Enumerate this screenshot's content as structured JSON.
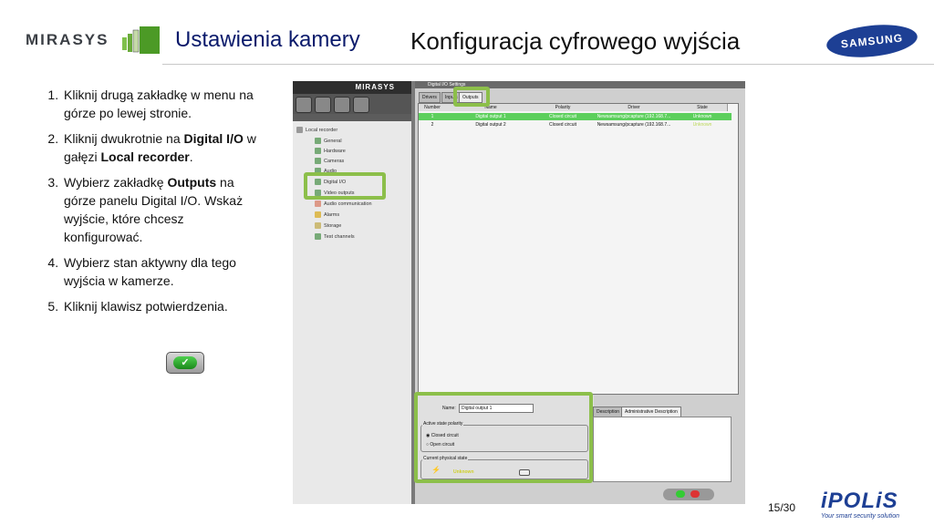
{
  "header": {
    "brand": "MIRASYS",
    "title": "Ustawienia kamery",
    "subtitle": "Konfiguracja cyfrowego wyjścia",
    "partner_logo": "SAMSUNG"
  },
  "steps": [
    {
      "pre": "Kliknij drugą zakładkę w menu na górze po lewej stronie.",
      "bold1": "",
      "mid": "",
      "bold2": "",
      "post": ""
    },
    {
      "pre": "Kliknij dwukrotnie na ",
      "bold1": "Digital I/O",
      "mid": " w gałęzi ",
      "bold2": "Local recorder",
      "post": "."
    },
    {
      "pre": "Wybierz zakładkę ",
      "bold1": "Outputs",
      "mid": " na górze panelu Digital I/O. Wskaż wyjście, które chcesz konfigurować.",
      "bold2": "",
      "post": ""
    },
    {
      "pre": "Wybierz stan aktywny dla tego wyjścia w kamerze.",
      "bold1": "",
      "mid": "",
      "bold2": "",
      "post": ""
    },
    {
      "pre": "Kliknij klawisz potwierdzenia.",
      "bold1": "",
      "mid": "",
      "bold2": "",
      "post": ""
    }
  ],
  "confirm_icon": "check-icon",
  "screenshot": {
    "app_header": "MIRASYS",
    "tree": {
      "root": "Local recorder",
      "items": [
        "General",
        "Hardware",
        "Cameras",
        "Audio",
        "Digital I/O",
        "Video outputs",
        "Audio communication",
        "Alarms",
        "Storage",
        "Test channels"
      ]
    },
    "window_title": "Digital I/O Settings",
    "tabs": [
      "Drivers",
      "Inputs",
      "Outputs"
    ],
    "columns": [
      "Number",
      "Name",
      "Polarity",
      "Driver",
      "State"
    ],
    "rows": [
      {
        "number": "1",
        "name": "Digital output 1",
        "polarity": "Closed circuit",
        "driver": "Newsamsung/pcapture (192.168.7...",
        "state": "Unknown"
      },
      {
        "number": "2",
        "name": "Digital output 2",
        "polarity": "Closed circuit",
        "driver": "Newsamsung/pcapture (192.168.7...",
        "state": "Unknown"
      }
    ],
    "form": {
      "name_label": "Name:",
      "name_value": "Digital output 1",
      "active_state_label": "Active state polarity",
      "option_closed": "Closed circuit",
      "option_open": "Open circuit",
      "physical_state_label": "Current physical state",
      "physical_state_value": "Unknown"
    },
    "desc_tabs": [
      "Description",
      "Administrative Description"
    ]
  },
  "footer": {
    "page": "15/30",
    "brand": "iPOLiS",
    "tagline": "Your smart security solution"
  }
}
